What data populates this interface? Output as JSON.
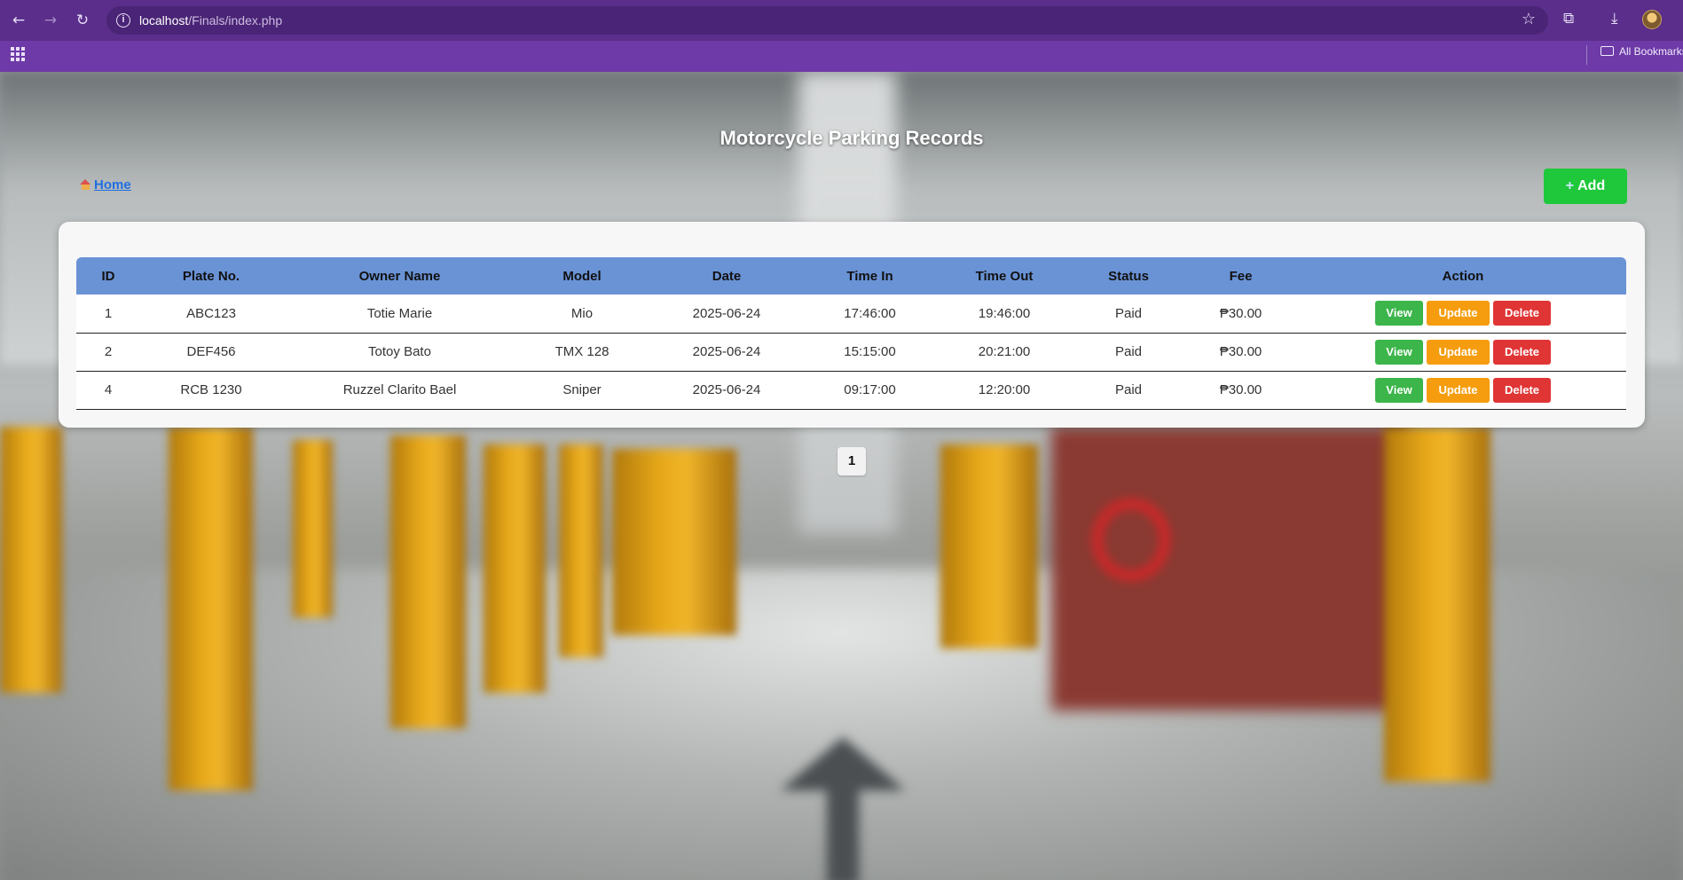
{
  "browser": {
    "url_host": "localhost",
    "url_path": "/Finals/index.php",
    "bookmarks_label": "All Bookmarks"
  },
  "page": {
    "title": "Motorcycle Parking Records",
    "home_link": "Home",
    "add_button": "Add"
  },
  "table": {
    "columns": [
      "ID",
      "Plate No.",
      "Owner Name",
      "Model",
      "Date",
      "Time In",
      "Time Out",
      "Status",
      "Fee",
      "Action"
    ],
    "rows": [
      {
        "id": "1",
        "plate": "ABC123",
        "owner": "Totie Marie",
        "model": "Mio",
        "date": "2025-06-24",
        "time_in": "17:46:00",
        "time_out": "19:46:00",
        "status": "Paid",
        "fee": "₱30.00"
      },
      {
        "id": "2",
        "plate": "DEF456",
        "owner": "Totoy Bato",
        "model": "TMX 128",
        "date": "2025-06-24",
        "time_in": "15:15:00",
        "time_out": "20:21:00",
        "status": "Paid",
        "fee": "₱30.00"
      },
      {
        "id": "4",
        "plate": "RCB 1230",
        "owner": "Ruzzel Clarito Bael",
        "model": "Sniper",
        "date": "2025-06-24",
        "time_in": "09:17:00",
        "time_out": "12:20:00",
        "status": "Paid",
        "fee": "₱30.00"
      }
    ],
    "actions": {
      "view": "View",
      "update": "Update",
      "delete": "Delete"
    }
  },
  "pagination": {
    "current_page": "1"
  },
  "colors": {
    "header_row": "#6a93d6",
    "add_button": "#1fc83b",
    "view_button": "#3cb54a",
    "update_button": "#f59d0e",
    "delete_button": "#e03535",
    "browser_frame": "#6d3aa8"
  },
  "icons": [
    "back-arrow-icon",
    "forward-arrow-icon",
    "reload-icon",
    "info-icon",
    "star-icon",
    "extensions-icon",
    "download-icon",
    "apps-grid-icon",
    "folder-icon",
    "home-icon",
    "plus-icon"
  ]
}
